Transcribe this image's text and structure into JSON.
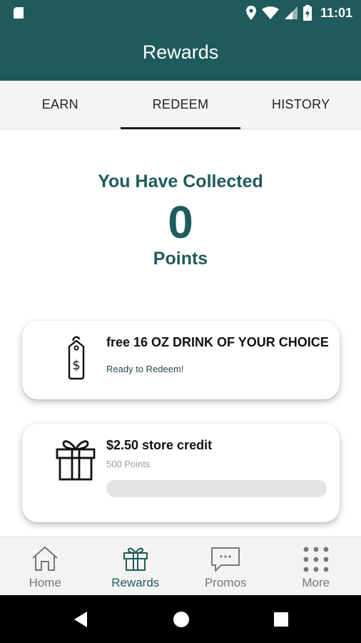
{
  "status_bar": {
    "time": "11:01"
  },
  "app_bar": {
    "title": "Rewards"
  },
  "tabs": [
    {
      "label": "EARN",
      "active": false
    },
    {
      "label": "REDEEM",
      "active": true
    },
    {
      "label": "HISTORY",
      "active": false
    }
  ],
  "points": {
    "heading": "You Have Collected",
    "value": "0",
    "unit": "Points"
  },
  "rewards": [
    {
      "title": "free 16 OZ DRINK OF YOUR CHOICE",
      "subtitle": "Ready to Redeem!",
      "icon": "price-tag-dollar-icon"
    },
    {
      "title": "$2.50 store credit",
      "subtitle": "500 Points",
      "icon": "gift-icon",
      "progress": 0
    }
  ],
  "bottom_nav": [
    {
      "label": "Home",
      "icon": "home-icon",
      "active": false
    },
    {
      "label": "Rewards",
      "icon": "gift-icon",
      "active": true
    },
    {
      "label": "Promos",
      "icon": "chat-bubble-icon",
      "active": false
    },
    {
      "label": "More",
      "icon": "grid-dots-icon",
      "active": false
    }
  ],
  "colors": {
    "primary": "#1f5b5c",
    "inactive_nav": "#777777",
    "progress_track": "#e4e4e4"
  }
}
